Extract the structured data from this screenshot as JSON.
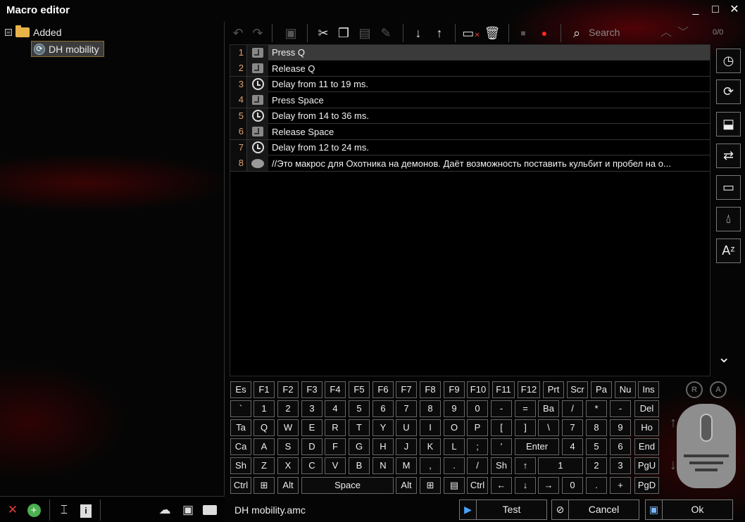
{
  "window": {
    "title": "Macro editor",
    "controls": [
      "_",
      "□",
      "✕"
    ]
  },
  "tree": {
    "folder_label": "Added",
    "expander": "−",
    "item_label": "DH mobility"
  },
  "left_toolbar": {
    "icons": [
      "delete-icon",
      "add-icon",
      "rename-icon",
      "info-icon",
      "cloud-icon",
      "save-icon",
      "open-folder-icon"
    ]
  },
  "toolbar": {
    "search_placeholder": "Search",
    "counter": "0/0"
  },
  "steps": [
    {
      "num": "1",
      "icon": "key",
      "text": "Press Q"
    },
    {
      "num": "2",
      "icon": "key",
      "text": "Release Q"
    },
    {
      "num": "3",
      "icon": "clock",
      "text": "Delay from 11 to 19 ms."
    },
    {
      "num": "4",
      "icon": "key",
      "text": "Press Space"
    },
    {
      "num": "5",
      "icon": "clock",
      "text": "Delay from 14 to 36 ms."
    },
    {
      "num": "6",
      "icon": "key",
      "text": "Release Space"
    },
    {
      "num": "7",
      "icon": "clock",
      "text": "Delay from 12 to 24 ms."
    },
    {
      "num": "8",
      "icon": "bubble",
      "text": "//Это макрос для Охотника на демонов. Даёт возможность поставить кульбит и пробел на о..."
    }
  ],
  "keyboard": {
    "row1": [
      "Es",
      "F1",
      "F2",
      "F3",
      "F4",
      "F5",
      "F6",
      "F7",
      "F8",
      "F9",
      "F10",
      "F11",
      "F12",
      "Prt",
      "Scr",
      "Pa",
      "Nu",
      "Ins"
    ],
    "row2": [
      "`",
      "1",
      "2",
      "3",
      "4",
      "5",
      "6",
      "7",
      "8",
      "9",
      "0",
      "-",
      "=",
      "Ba",
      "/",
      "*",
      "-",
      "Del"
    ],
    "row3": [
      "Ta",
      "Q",
      "W",
      "E",
      "R",
      "T",
      "Y",
      "U",
      "I",
      "O",
      "P",
      "[",
      "]",
      "\\",
      "7",
      "8",
      "9",
      "Ho"
    ],
    "row4": [
      "Ca",
      "A",
      "S",
      "D",
      "F",
      "G",
      "H",
      "J",
      "K",
      "L",
      ";",
      "'",
      "Enter",
      "4",
      "5",
      "6",
      "End"
    ],
    "row5": [
      "Sh",
      "Z",
      "X",
      "C",
      "V",
      "B",
      "N",
      "M",
      ",",
      ".",
      "/",
      "Sh",
      "↑",
      "1",
      "2",
      "3",
      "PgU"
    ],
    "row6": [
      "Ctrl",
      "⊞",
      "Alt",
      "Space",
      "Alt",
      "⊞",
      "▤",
      "Ctrl",
      "←",
      "↓",
      "→",
      "0",
      ".",
      "+",
      "PgD"
    ]
  },
  "mouse": {
    "btn_r": "R",
    "btn_a": "A"
  },
  "bottom": {
    "filename": "DH mobility.amc",
    "test_label": "Test",
    "cancel_label": "Cancel",
    "ok_label": "Ok"
  }
}
